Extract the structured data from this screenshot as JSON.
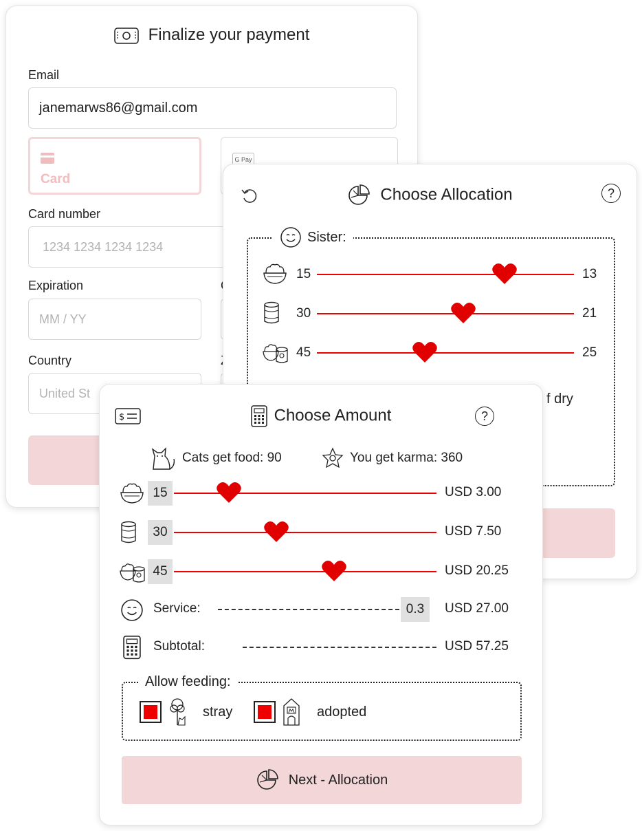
{
  "payment": {
    "title": "Finalize your payment",
    "email_label": "Email",
    "email_value": "janemarws86@gmail.com",
    "tab_card_label": "Card",
    "tab_gpay_label": "G Pay",
    "card_number_label": "Card number",
    "card_number_placeholder": "1234 1234 1234 1234",
    "expiration_label": "Expiration",
    "expiration_placeholder": "MM / YY",
    "cvc_label_partial": "C",
    "country_label": "Country",
    "country_value_partial": "United St",
    "zip_label_partial": "Z"
  },
  "allocation": {
    "title": "Choose Allocation",
    "help": "?",
    "legend": "Sister:",
    "rows": [
      {
        "icon": "dry-food-bowl-icon",
        "left": "15",
        "right": "13",
        "level": 0.73
      },
      {
        "icon": "can-icon",
        "left": "30",
        "right": "21",
        "level": 0.57
      },
      {
        "icon": "mixed-food-icon",
        "left": "45",
        "right": "25",
        "level": 0.42
      }
    ],
    "partial_text": "f dry"
  },
  "amount": {
    "title": "Choose Amount",
    "help": "?",
    "cats_food": "Cats get food: 90",
    "karma": "You get karma: 360",
    "rows": [
      {
        "icon": "dry-food-bowl-icon",
        "qty": "15",
        "price": "USD 3.00",
        "level": 0.21
      },
      {
        "icon": "can-icon",
        "qty": "30",
        "price": "USD 7.50",
        "level": 0.39
      },
      {
        "icon": "mixed-food-icon",
        "qty": "45",
        "price": "USD 20.25",
        "level": 0.61
      }
    ],
    "service_label": "Service:",
    "service_value": "0.3",
    "service_price": "USD 27.00",
    "subtotal_label": "Subtotal:",
    "subtotal_price": "USD 57.25",
    "allow_label": "Allow feeding:",
    "stray_label": "stray",
    "adopted_label": "adopted",
    "next_label": "Next - Allocation"
  },
  "colors": {
    "accent": "#e00000",
    "button": "#f3d6d7"
  }
}
